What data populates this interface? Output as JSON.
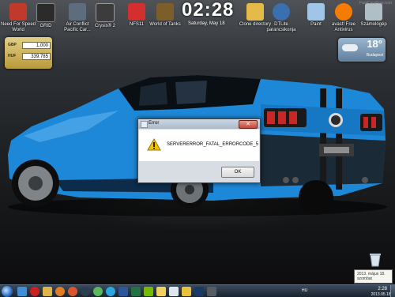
{
  "desktop_icons": [
    {
      "label": "Need For Speed World",
      "icon": "nfs-world-icon",
      "color": "#c0392b"
    },
    {
      "label": "GRID",
      "icon": "grid-game-icon",
      "color": "#2b2b2b"
    },
    {
      "label": "Air Conflict Pacific Car...",
      "icon": "air-conflict-icon",
      "color": "#5d6d7e"
    },
    {
      "label": "Crysis® 2",
      "icon": "crysis-icon",
      "color": "#3c3c3c"
    },
    {
      "label": "NFS11",
      "icon": "nfs11-icon",
      "color": "#d32f2f"
    },
    {
      "label": "World of Tanks",
      "icon": "world-of-tanks-icon",
      "color": "#7b5e2a"
    },
    {
      "label": "Clone directory",
      "icon": "folder-icon",
      "color": "#e5b94a"
    },
    {
      "label": "DTLite parancsikonja",
      "icon": "daemon-tools-icon",
      "color": "#3a6fb0"
    },
    {
      "label": "Paint",
      "icon": "paint-icon",
      "color": "#9fc5e8"
    },
    {
      "label": "avast! Free Antivirus",
      "icon": "avast-icon",
      "color": "#f57c00"
    },
    {
      "label": "Számológép",
      "icon": "calculator-icon",
      "color": "#b0bec5"
    }
  ],
  "clock_gadget": {
    "time": "02:28",
    "date": "Saturday, May 18"
  },
  "watermark": "FastCarsRow.com",
  "currency_gadget": {
    "rows": [
      {
        "code": "GBP",
        "value": "1.000"
      },
      {
        "code": "HUF",
        "value": "339.785"
      }
    ]
  },
  "weather_gadget": {
    "temp": "18°",
    "city": "Budapest"
  },
  "dialog": {
    "title": "Error",
    "message": "SERVERERROR_FATAL_ERRORCODE_5",
    "ok_label": "OK",
    "close_symbol": "✕"
  },
  "tooltip": {
    "line1": "2013. május 18.",
    "line2": "szombat"
  },
  "taskbar": {
    "language": "HU",
    "time": "2:28",
    "date": "2013.05.18."
  },
  "colors": {
    "car_blue": "#1e88d8",
    "stripe_black": "#141414",
    "accent_red": "#c62828"
  }
}
